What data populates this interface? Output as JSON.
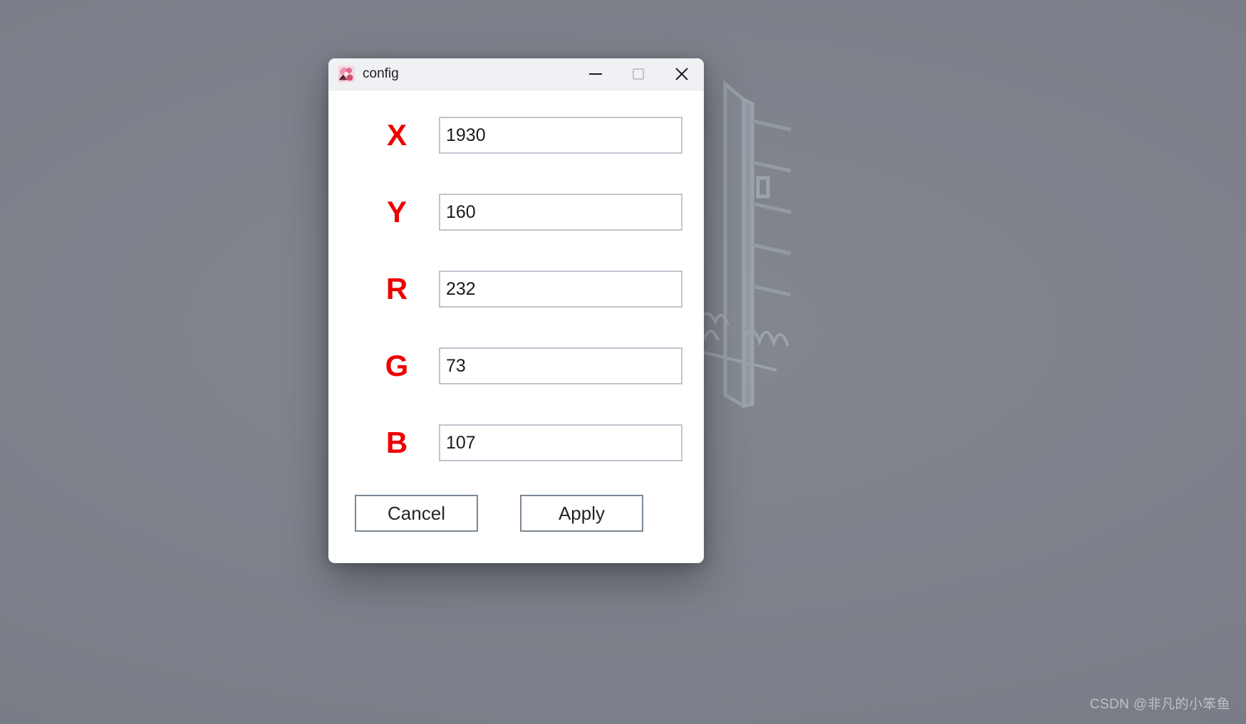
{
  "desktop": {
    "watermark": "CSDN @非凡的小笨鱼",
    "background_color": "#7e828c"
  },
  "dialog": {
    "title": "config",
    "icon": "app-avatar-icon",
    "window_controls": {
      "minimize": "minimize-icon",
      "maximize": "maximize-icon",
      "close": "close-icon"
    },
    "accent_label_color": "#ec0000",
    "fields": [
      {
        "label": "X",
        "value": "1930",
        "placeholder": ""
      },
      {
        "label": "Y",
        "value": "160",
        "placeholder": ""
      },
      {
        "label": "R",
        "value": "232",
        "placeholder": ""
      },
      {
        "label": "G",
        "value": "73",
        "placeholder": ""
      },
      {
        "label": "B",
        "value": "107",
        "placeholder": ""
      }
    ],
    "buttons": {
      "cancel": "Cancel",
      "apply": "Apply"
    }
  }
}
